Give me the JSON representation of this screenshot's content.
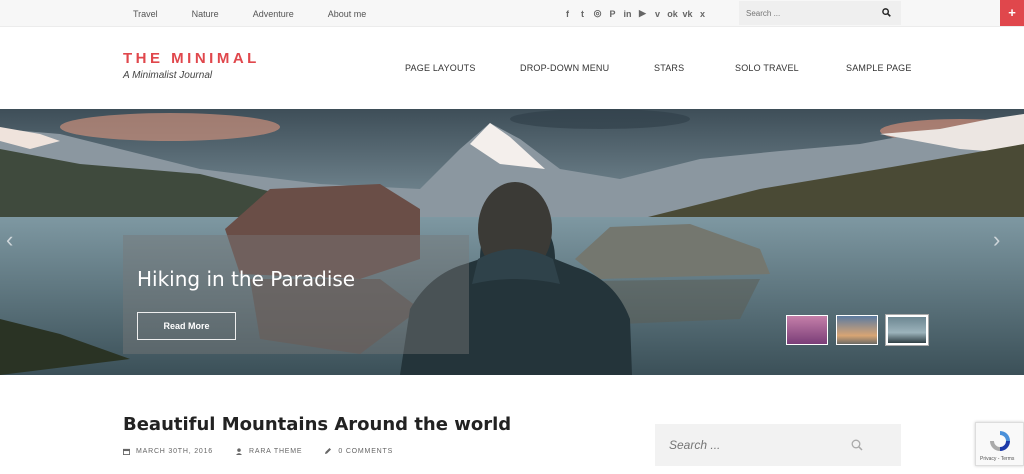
{
  "topbar": {
    "links": [
      "Travel",
      "Nature",
      "Adventure",
      "About me"
    ],
    "social_icons": [
      "facebook-icon",
      "twitter-icon",
      "instagram-icon",
      "pinterest-icon",
      "linkedin-icon",
      "youtube-icon",
      "vimeo-icon",
      "odnoklassniki-icon",
      "vk-icon",
      "xing-icon"
    ],
    "social_glyphs": [
      "f",
      "t",
      "◎",
      "P",
      "in",
      "▶",
      "v",
      "ok",
      "vk",
      "x"
    ],
    "search_placeholder": "Search ..."
  },
  "header": {
    "site_title": "THE MINIMAL",
    "tagline": "A Minimalist Journal",
    "nav": [
      "PAGE LAYOUTS",
      "DROP-DOWN MENU",
      "STARS",
      "SOLO TRAVEL",
      "SAMPLE PAGE"
    ]
  },
  "plus_button": "+",
  "hero": {
    "slide_title": "Hiking in the Paradise",
    "read_more": "Read More",
    "prev_arrow": "‹",
    "next_arrow": "›"
  },
  "post": {
    "title": "Beautiful Mountains Around the world",
    "date": "MARCH 30TH, 2016",
    "author": "RARA THEME",
    "comments": "0 COMMENTS"
  },
  "sidebar": {
    "search_placeholder": "Search ..."
  },
  "recaptcha": {
    "label": "Privacy - Terms"
  },
  "colors": {
    "accent": "#e0474c",
    "topbar_bg": "#f7f7f7",
    "search_bg": "#f2f2f2"
  }
}
